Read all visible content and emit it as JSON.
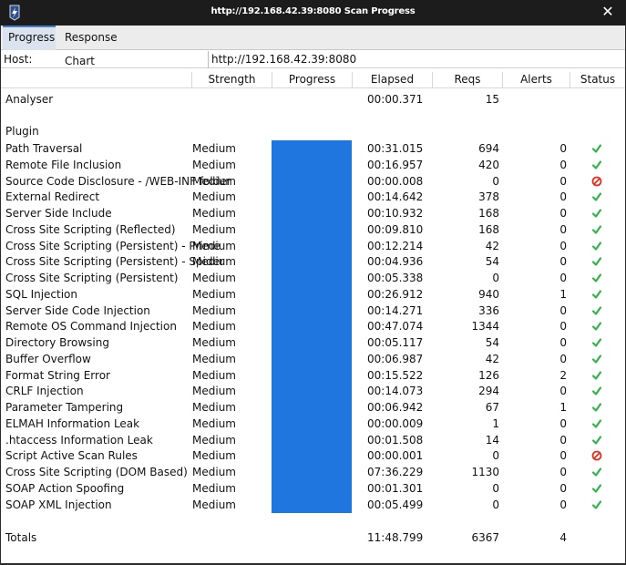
{
  "window": {
    "title": "http://192.168.42.39:8080 Scan Progress"
  },
  "tabs": [
    {
      "label": "Progress",
      "active": true
    },
    {
      "label": "Response Chart",
      "active": false
    }
  ],
  "host": {
    "label": "Host:",
    "value": "http://192.168.42.39:8080"
  },
  "columns": [
    "Strength",
    "Progress",
    "Elapsed",
    "Reqs",
    "Alerts",
    "Status"
  ],
  "analyser": {
    "name": "Analyser",
    "elapsed": "00:00.371",
    "reqs": "15"
  },
  "plugin_section_label": "Plugin",
  "plugins": [
    {
      "name": "Path Traversal",
      "strength": "Medium",
      "elapsed": "00:31.015",
      "reqs": "694",
      "alerts": "0",
      "status": "ok"
    },
    {
      "name": "Remote File Inclusion",
      "strength": "Medium",
      "elapsed": "00:16.957",
      "reqs": "420",
      "alerts": "0",
      "status": "ok"
    },
    {
      "name": "Source Code Disclosure - /WEB-INF folder",
      "strength": "Medium",
      "elapsed": "00:00.008",
      "reqs": "0",
      "alerts": "0",
      "status": "skipped"
    },
    {
      "name": "External Redirect",
      "strength": "Medium",
      "elapsed": "00:14.642",
      "reqs": "378",
      "alerts": "0",
      "status": "ok"
    },
    {
      "name": "Server Side Include",
      "strength": "Medium",
      "elapsed": "00:10.932",
      "reqs": "168",
      "alerts": "0",
      "status": "ok"
    },
    {
      "name": "Cross Site Scripting (Reflected)",
      "strength": "Medium",
      "elapsed": "00:09.810",
      "reqs": "168",
      "alerts": "0",
      "status": "ok"
    },
    {
      "name": "Cross Site Scripting (Persistent) - Prime",
      "strength": "Medium",
      "elapsed": "00:12.214",
      "reqs": "42",
      "alerts": "0",
      "status": "ok"
    },
    {
      "name": "Cross Site Scripting (Persistent) - Spider",
      "strength": "Medium",
      "elapsed": "00:04.936",
      "reqs": "54",
      "alerts": "0",
      "status": "ok"
    },
    {
      "name": "Cross Site Scripting (Persistent)",
      "strength": "Medium",
      "elapsed": "00:05.338",
      "reqs": "0",
      "alerts": "0",
      "status": "ok"
    },
    {
      "name": "SQL Injection",
      "strength": "Medium",
      "elapsed": "00:26.912",
      "reqs": "940",
      "alerts": "1",
      "status": "ok"
    },
    {
      "name": "Server Side Code Injection",
      "strength": "Medium",
      "elapsed": "00:14.271",
      "reqs": "336",
      "alerts": "0",
      "status": "ok"
    },
    {
      "name": "Remote OS Command Injection",
      "strength": "Medium",
      "elapsed": "00:47.074",
      "reqs": "1344",
      "alerts": "0",
      "status": "ok"
    },
    {
      "name": "Directory Browsing",
      "strength": "Medium",
      "elapsed": "00:05.117",
      "reqs": "54",
      "alerts": "0",
      "status": "ok"
    },
    {
      "name": "Buffer Overflow",
      "strength": "Medium",
      "elapsed": "00:06.987",
      "reqs": "42",
      "alerts": "0",
      "status": "ok"
    },
    {
      "name": "Format String Error",
      "strength": "Medium",
      "elapsed": "00:15.522",
      "reqs": "126",
      "alerts": "2",
      "status": "ok"
    },
    {
      "name": "CRLF Injection",
      "strength": "Medium",
      "elapsed": "00:14.073",
      "reqs": "294",
      "alerts": "0",
      "status": "ok"
    },
    {
      "name": "Parameter Tampering",
      "strength": "Medium",
      "elapsed": "00:06.942",
      "reqs": "67",
      "alerts": "1",
      "status": "ok"
    },
    {
      "name": "ELMAH Information Leak",
      "strength": "Medium",
      "elapsed": "00:00.009",
      "reqs": "1",
      "alerts": "0",
      "status": "ok"
    },
    {
      "name": ".htaccess Information Leak",
      "strength": "Medium",
      "elapsed": "00:01.508",
      "reqs": "14",
      "alerts": "0",
      "status": "ok"
    },
    {
      "name": "Script Active Scan Rules",
      "strength": "Medium",
      "elapsed": "00:00.001",
      "reqs": "0",
      "alerts": "0",
      "status": "skipped"
    },
    {
      "name": "Cross Site Scripting (DOM Based)",
      "strength": "Medium",
      "elapsed": "07:36.229",
      "reqs": "1130",
      "alerts": "0",
      "status": "ok"
    },
    {
      "name": "SOAP Action Spoofing",
      "strength": "Medium",
      "elapsed": "00:01.301",
      "reqs": "0",
      "alerts": "0",
      "status": "ok"
    },
    {
      "name": "SOAP XML Injection",
      "strength": "Medium",
      "elapsed": "00:05.499",
      "reqs": "0",
      "alerts": "0",
      "status": "ok"
    }
  ],
  "progress_percent": 100,
  "totals": {
    "label": "Totals",
    "elapsed": "11:48.799",
    "reqs": "6367",
    "alerts": "4"
  },
  "colors": {
    "progress_fill": "#1e76de",
    "status_ok": "#2fb34a",
    "status_skipped": "#e0301e"
  },
  "icons": {
    "status_ok": "check-icon",
    "status_skipped": "stop-icon",
    "app": "zap-icon",
    "close": "close-icon"
  }
}
